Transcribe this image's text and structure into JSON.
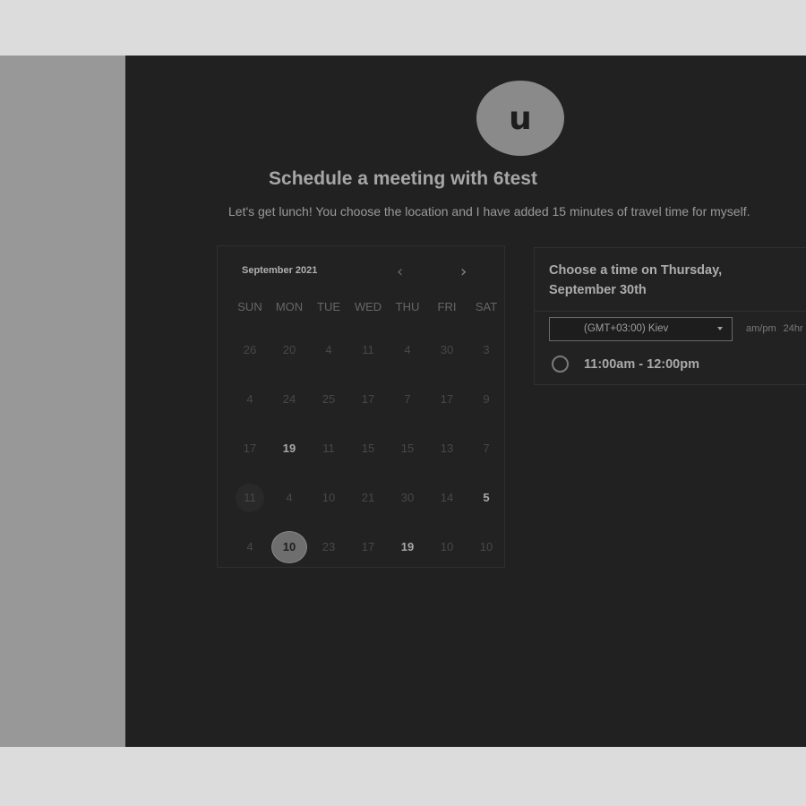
{
  "colors": {
    "backdrop": "#dcdcdc",
    "page_bg": "#212121",
    "sidebar_bg": "#989898",
    "avatar_bg": "#8a8a8a"
  },
  "avatar": {
    "initial": "u"
  },
  "header": {
    "title": "Schedule a meeting with 6test",
    "description": "Let's get lunch! You choose the location and I have added 15 minutes of travel time for myself."
  },
  "calendar": {
    "month_label": "September 2021",
    "prev_icon": "‹",
    "next_icon": "›",
    "weekdays": [
      "SUN",
      "MON",
      "TUE",
      "WED",
      "THU",
      "FRI",
      "SAT"
    ],
    "weeks": [
      [
        "26",
        "20",
        "4",
        "11",
        "4",
        "30",
        "3"
      ],
      [
        "4",
        "24",
        "25",
        "17",
        "7",
        "17",
        "9"
      ],
      [
        "17",
        "19",
        "11",
        "15",
        "15",
        "13",
        "7"
      ],
      [
        "11",
        "4",
        "10",
        "21",
        "30",
        "14",
        "5"
      ],
      [
        "4",
        "10",
        "23",
        "17",
        "19",
        "10",
        "10"
      ]
    ]
  },
  "time_panel": {
    "heading_line1": "Choose a time on Thursday,",
    "heading_line2": "September 30th",
    "timezone": "(GMT+03:00) Kiev",
    "format_ampm": "am/pm",
    "format_24h": "24hr",
    "slots": [
      "11:00am - 12:00pm"
    ]
  }
}
